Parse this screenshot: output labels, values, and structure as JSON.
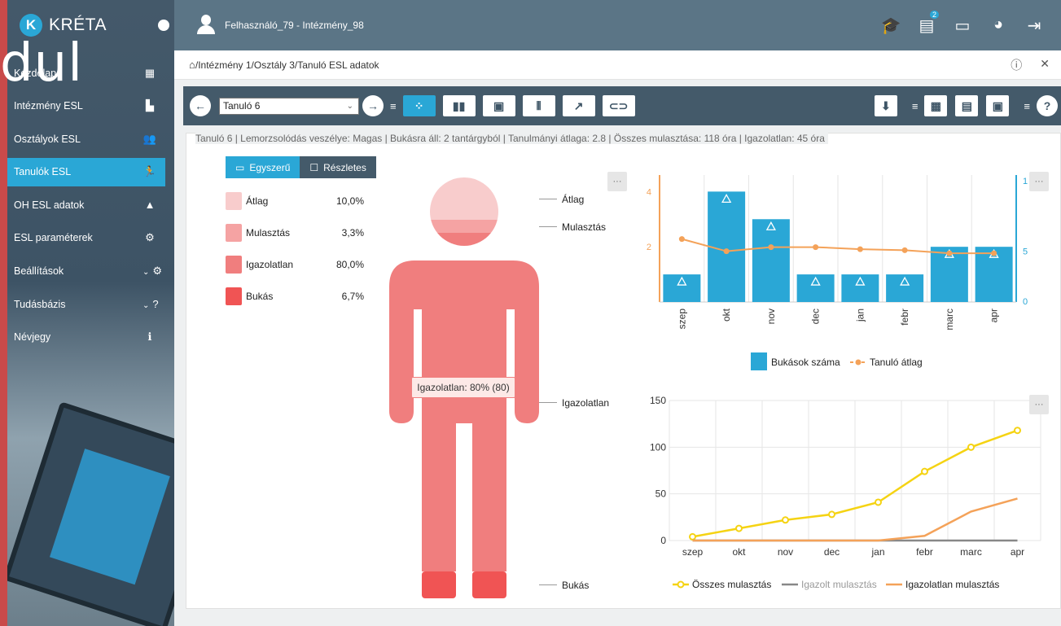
{
  "overlay_text": "dul",
  "sidebar": {
    "brand": "KRÉTA",
    "logo_letter": "K",
    "items": [
      {
        "label": "Kezdőlap",
        "icon": "dashboard-icon",
        "glyph": "▦"
      },
      {
        "label": "Intézmény ESL",
        "icon": "building-icon",
        "glyph": "▙"
      },
      {
        "label": "Osztályok ESL",
        "icon": "group-icon",
        "glyph": "👥"
      },
      {
        "label": "Tanulók ESL",
        "icon": "runner-icon",
        "glyph": "🏃",
        "active": true
      },
      {
        "label": "OH ESL adatok",
        "icon": "warning-icon",
        "glyph": "▲"
      },
      {
        "label": "ESL paraméterek",
        "icon": "settings-box-icon",
        "glyph": "⚙"
      },
      {
        "label": "Beállítások",
        "icon": "gear-icon",
        "glyph": "⚙",
        "chevron": "⌄"
      },
      {
        "label": "Tudásbázis",
        "icon": "help-icon",
        "glyph": "?",
        "chevron": "⌄"
      },
      {
        "label": "Névjegy",
        "icon": "info-icon",
        "glyph": "ℹ"
      }
    ]
  },
  "topbar": {
    "user": "Felhasználó_79 - Intézmény_98",
    "message_badge": "2"
  },
  "breadcrumb": "/Intézmény 1/Osztály 3/Tanuló ESL adatok",
  "toolbar": {
    "student_select": "Tanuló 6"
  },
  "info_line": "Tanuló 6 | Lemorzsolódás veszélye: Magas | Bukásra áll: 2 tantárgyból | Tanulmányi átlaga: 2.8 | Összes mulasztása: 118 óra | Igazolatlan: 45 óra",
  "view_toggle": {
    "simple": "Egyszerű",
    "detailed": "Részletes"
  },
  "colors": {
    "accent": "#2aa7d6",
    "dark": "#445a6a"
  },
  "chart_data": [
    {
      "type": "pictorial",
      "categories": [
        "Átlag",
        "Mulasztás",
        "Igazolatlan",
        "Bukás"
      ],
      "values": [
        10.0,
        3.3,
        80.0,
        6.7
      ],
      "value_labels": [
        "10,0%",
        "3,3%",
        "80,0%",
        "6,7%"
      ],
      "colors": [
        "#f8cccc",
        "#f5a3a3",
        "#f07e7e",
        "#f05454"
      ],
      "tooltip": "Igazolatlan: 80% (80)"
    },
    {
      "type": "bar",
      "categories": [
        "szep",
        "okt",
        "nov",
        "dec",
        "jan",
        "febr",
        "marc",
        "apr"
      ],
      "series": [
        {
          "name": "Bukások száma",
          "values": [
            1,
            4,
            3,
            1,
            1,
            1,
            2,
            2
          ]
        },
        {
          "name": "Tanuló átlag",
          "type": "line",
          "values": [
            6.2,
            5.0,
            5.4,
            5.4,
            5.2,
            5.1,
            4.8,
            4.8
          ]
        }
      ],
      "y_left_ticks": [
        "2",
        "4"
      ],
      "y_right_ticks": [
        "0",
        "5",
        "1"
      ],
      "legend": "bottom"
    },
    {
      "type": "line",
      "categories": [
        "szep",
        "okt",
        "nov",
        "dec",
        "jan",
        "febr",
        "marc",
        "apr"
      ],
      "series": [
        {
          "name": "Összes mulasztás",
          "values": [
            4,
            13,
            22,
            28,
            41,
            74,
            100,
            118
          ]
        },
        {
          "name": "Igazolt mulasztás",
          "values": [
            0,
            0,
            0,
            0,
            0,
            0,
            0,
            0
          ]
        },
        {
          "name": "Igazolatlan mulasztás",
          "values": [
            0,
            0,
            0,
            0,
            0,
            5,
            31,
            45
          ]
        }
      ],
      "ylim": [
        0,
        150
      ],
      "y_ticks": [
        "0",
        "50",
        "100",
        "150"
      ],
      "legend": "bottom"
    }
  ]
}
